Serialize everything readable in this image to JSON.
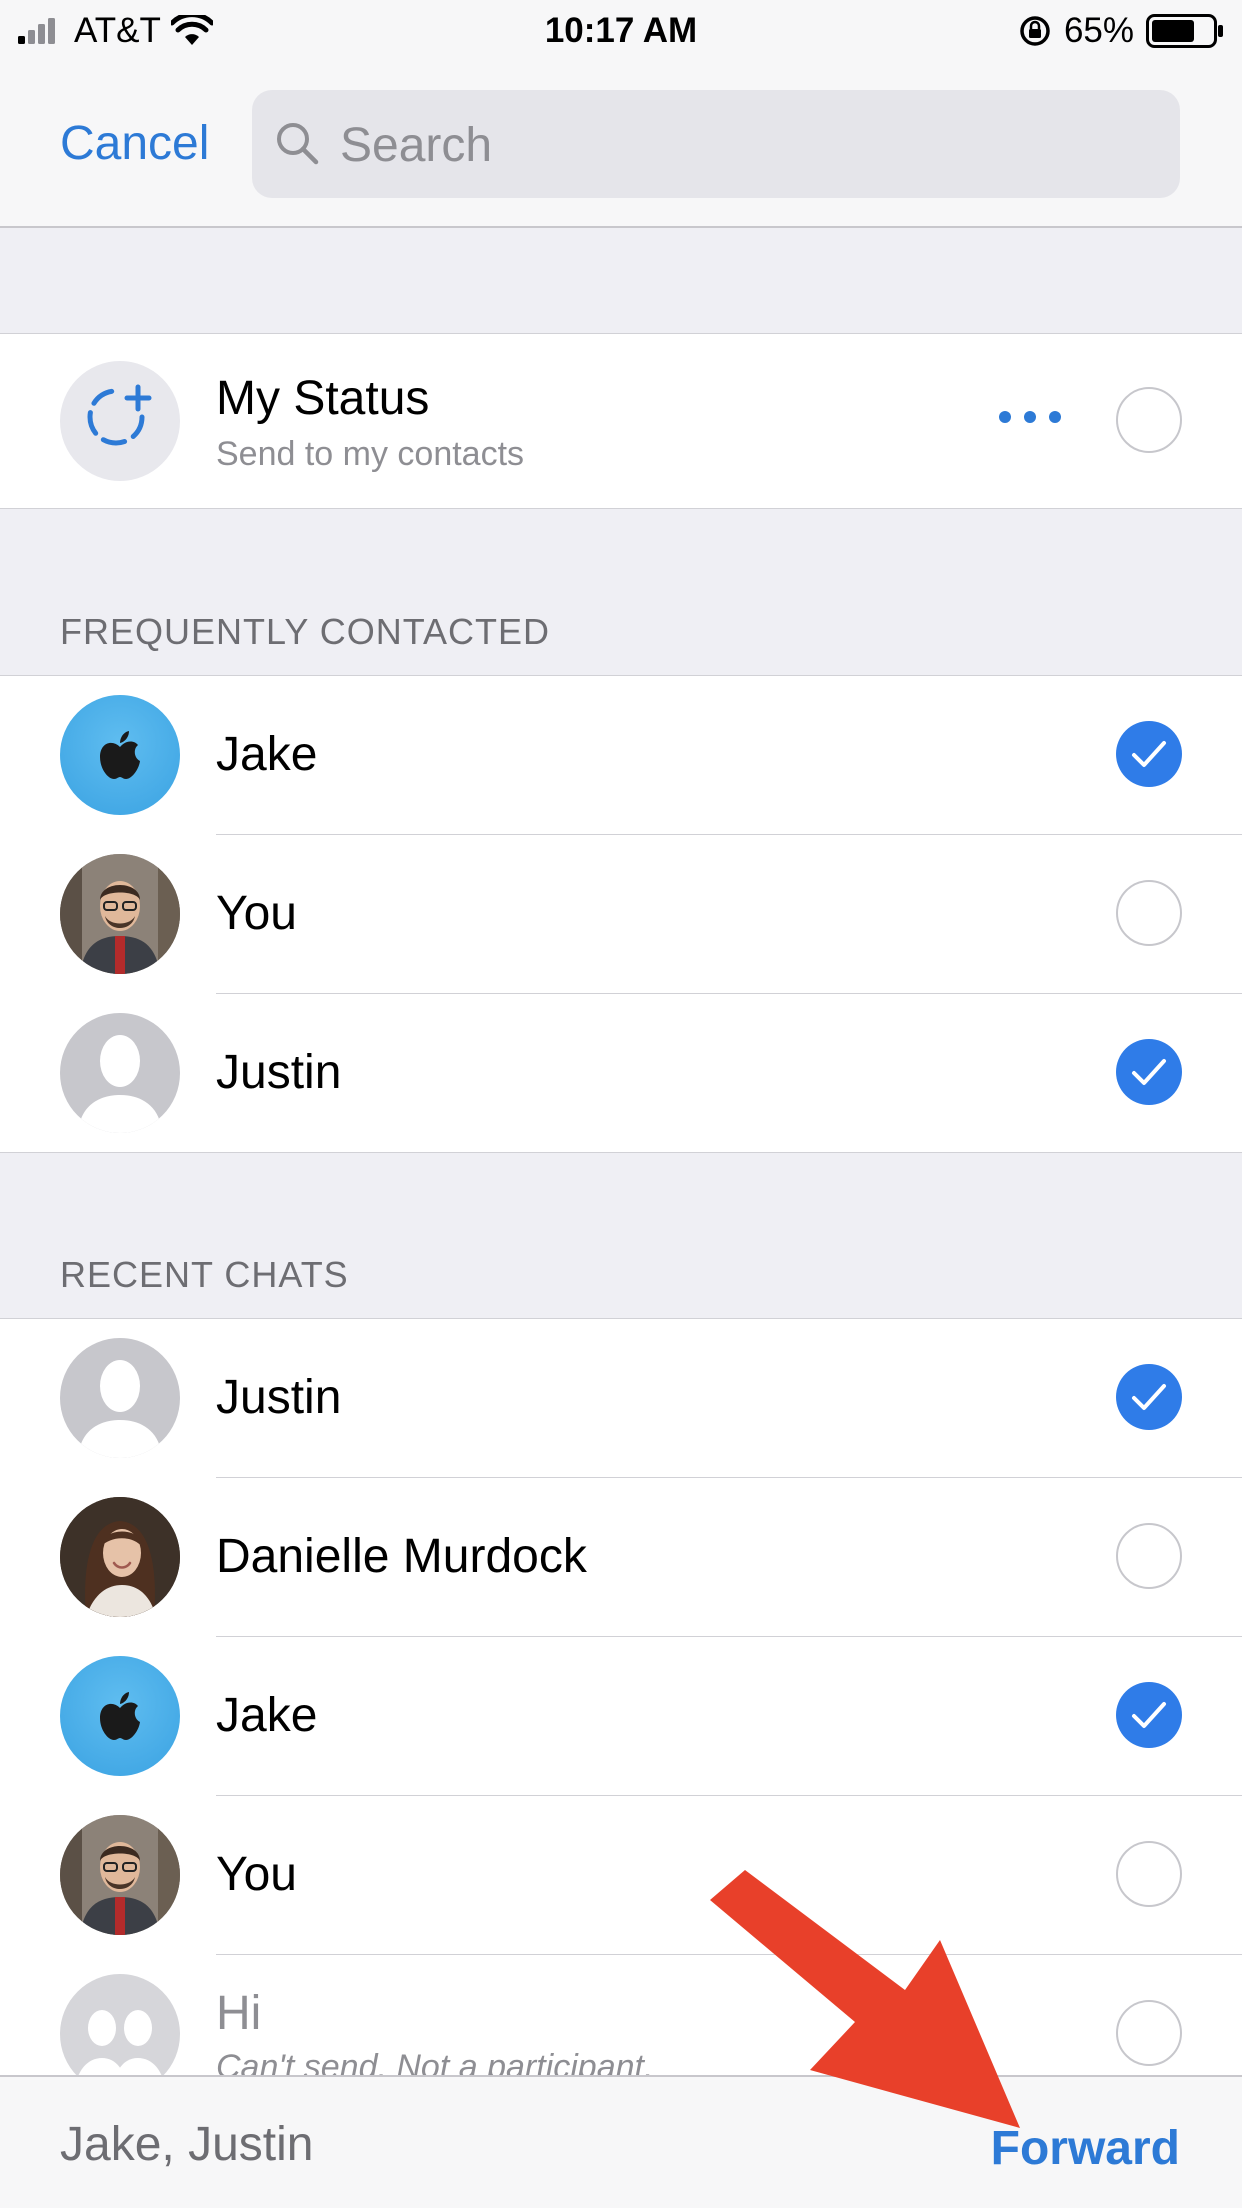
{
  "status_bar": {
    "carrier": "AT&T",
    "time": "10:17 AM",
    "battery_percent": "65%"
  },
  "nav": {
    "cancel_label": "Cancel",
    "search_placeholder": "Search"
  },
  "my_status": {
    "title": "My Status",
    "subtitle": "Send to my contacts",
    "selected": false
  },
  "frequently_contacted": {
    "header": "FREQUENTLY CONTACTED",
    "items": [
      {
        "name": "Jake",
        "avatar": "apple-logo-avatar",
        "selected": true
      },
      {
        "name": "You",
        "avatar": "photo-man-avatar",
        "selected": false
      },
      {
        "name": "Justin",
        "avatar": "default-person-avatar",
        "selected": true
      }
    ]
  },
  "recent_chats": {
    "header": "RECENT CHATS",
    "items": [
      {
        "name": "Justin",
        "avatar": "default-person-avatar",
        "selected": true
      },
      {
        "name": "Danielle Murdock",
        "avatar": "photo-woman-avatar",
        "selected": false
      },
      {
        "name": "Jake",
        "avatar": "apple-logo-avatar",
        "selected": true
      },
      {
        "name": "You",
        "avatar": "photo-man-avatar",
        "selected": false
      },
      {
        "name": "Hi",
        "subtitle": "Can't send. Not a participant.",
        "avatar": "group-avatar",
        "selected": false,
        "disabled": true
      }
    ]
  },
  "bottom_bar": {
    "selected_names": "Jake, Justin",
    "forward_label": "Forward"
  },
  "colors": {
    "accent": "#2d7ad6",
    "check_fill": "#2f7ce8",
    "arrow": "#e8402a"
  }
}
